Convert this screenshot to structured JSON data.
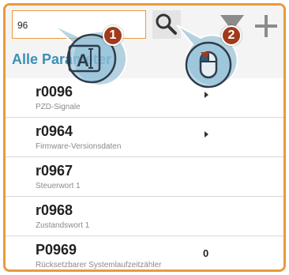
{
  "search": {
    "value": "96"
  },
  "header": {
    "category_title": "Alle Parameter"
  },
  "rows": [
    {
      "title": "r0096",
      "description": "PZD-Signale",
      "has_arrow": true,
      "value": ""
    },
    {
      "title": "r0964",
      "description": "Firmware-Versionsdaten",
      "has_arrow": true,
      "value": ""
    },
    {
      "title": "r0967",
      "description": "Steuerwort 1",
      "has_arrow": false,
      "value": ""
    },
    {
      "title": "r0968",
      "description": "Zustandswort 1",
      "has_arrow": false,
      "value": ""
    },
    {
      "title": "P0969",
      "description": "Rücksetzbarer Systemlaufzeitzähler",
      "has_arrow": false,
      "value": "0"
    }
  ],
  "callouts": [
    {
      "number": "1",
      "icon": "text-input-icon"
    },
    {
      "number": "2",
      "icon": "mouse-click-icon"
    }
  ],
  "colors": {
    "accent": "#e89b3c",
    "title_blue": "#3a90b6",
    "badge": "#a13a1c"
  }
}
